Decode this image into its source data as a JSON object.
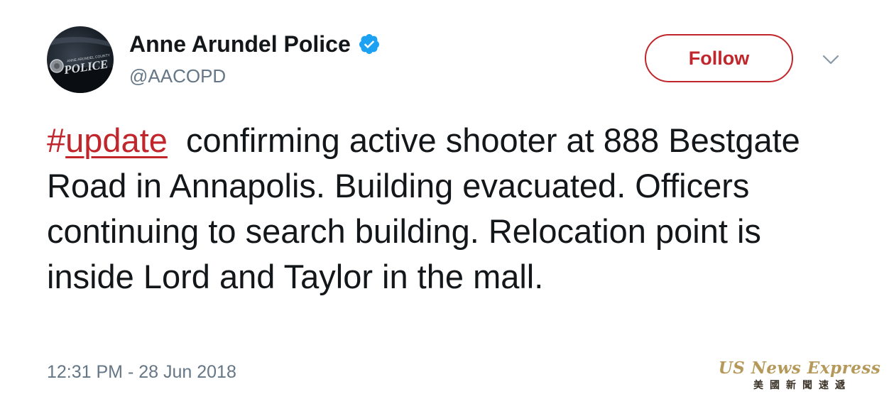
{
  "user": {
    "display_name": "Anne Arundel Police",
    "handle": "@AACOPD",
    "verified": true,
    "avatar_text": "POLICE"
  },
  "actions": {
    "follow_label": "Follow",
    "more_icon": "chevron-down-icon"
  },
  "tweet": {
    "hashtag_symbol": "#",
    "hashtag_word": "update",
    "text": "  confirming active shooter at 888 Bestgate Road in Annapolis. Building evacuated. Officers continuing to search building. Relocation point is inside Lord and Taylor in the mall.",
    "timestamp": "12:31 PM - 28 Jun 2018"
  },
  "watermark": {
    "title": "US News Express",
    "subtitle": "美國新聞速遞"
  },
  "colors": {
    "accent": "#c0262b",
    "verified": "#1da1f2",
    "secondary_text": "#657786",
    "primary_text": "#14171a",
    "watermark": "#b5995a"
  }
}
